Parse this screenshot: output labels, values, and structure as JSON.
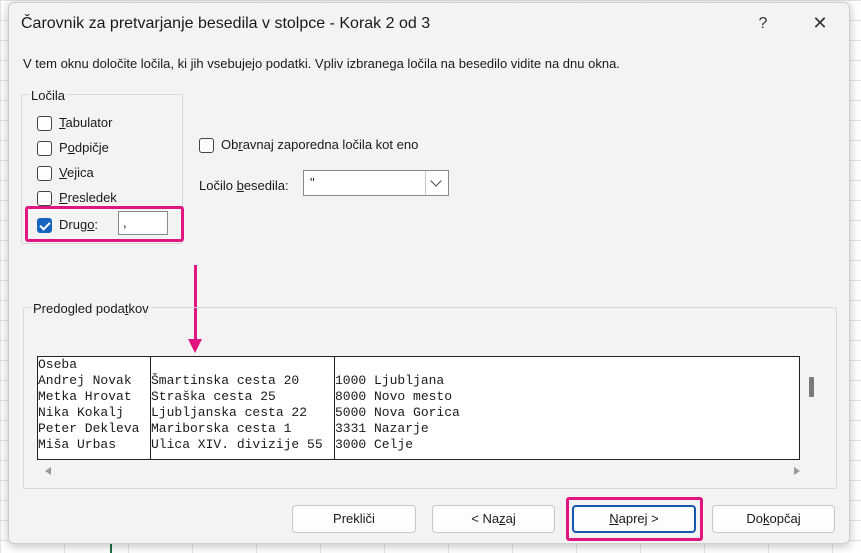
{
  "dialog": {
    "title": "Čarovnik za pretvarjanje besedila v stolpce - Korak 2 od 3",
    "help": "?",
    "close": "✕",
    "description": "V tem oknu določite ločila, ki jih vsebujejo podatki. Vpliv izbranega ločila na besedilo vidite na dnu okna."
  },
  "delimiters": {
    "group_label": "Ločila",
    "items": [
      {
        "pre": "",
        "acc": "T",
        "post": "abulator",
        "checked": false
      },
      {
        "pre": "P",
        "acc": "o",
        "post": "dpičje",
        "checked": false
      },
      {
        "pre": "",
        "acc": "V",
        "post": "ejica",
        "checked": false
      },
      {
        "pre": "",
        "acc": "P",
        "post": "resledek",
        "checked": false
      },
      {
        "pre": "Drug",
        "acc": "o",
        "post": ":",
        "checked": true
      }
    ],
    "other_value": ","
  },
  "consecutive": {
    "pre": "Ob",
    "acc": "r",
    "post": "avnaj zaporedna ločila kot eno",
    "checked": false
  },
  "qualifier": {
    "pre": "Ločilo ",
    "acc": "b",
    "post": "esedila:",
    "value": "\""
  },
  "preview": {
    "group_label_pre": "Predogled poda",
    "group_label_acc": "t",
    "group_label_post": "kov",
    "columns": [
      [
        "Oseba",
        "Andrej Novak",
        "Metka Hrovat",
        "Nika Kokalj",
        "Peter Dekleva",
        "Miša Urbas"
      ],
      [
        "",
        "Šmartinska cesta 20",
        "Straška cesta 25",
        "Ljubljanska cesta 22",
        "Mariborska cesta 1",
        "Ulica XIV. divizije 55"
      ],
      [
        "",
        "1000 Ljubljana",
        "8000 Novo mesto",
        "5000 Nova Gorica",
        "3331 Nazarje",
        "3000 Celje"
      ]
    ]
  },
  "buttons": {
    "cancel": "Prekliči",
    "back_pre": "< Na",
    "back_acc": "z",
    "back_post": "aj",
    "next_pre": "",
    "next_acc": "N",
    "next_post": "aprej >",
    "finish_pre": "Do",
    "finish_acc": "k",
    "finish_post": "op",
    "finish_tail": "čaj"
  },
  "colors": {
    "highlight": "#e0157f",
    "checkbox_checked": "#1565c0",
    "primary_border": "#1557b0"
  }
}
